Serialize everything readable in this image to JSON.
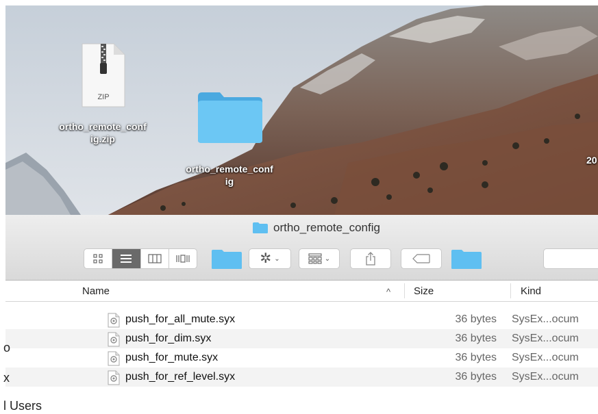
{
  "desktop": {
    "zip_file": {
      "badge": "ZIP",
      "label_line1": "ortho_remote_conf",
      "label_line2": "ig.zip"
    },
    "folder": {
      "label_line1": "ortho_remote_conf",
      "label_line2": "ig"
    },
    "clipped_label": "20"
  },
  "finder": {
    "title": "ortho_remote_config",
    "columns": {
      "name": "Name",
      "size": "Size",
      "kind": "Kind",
      "sort_indicator": "^"
    },
    "files": [
      {
        "name": "push_for_all_mute.syx",
        "size": "36 bytes",
        "kind": "SysEx...ocum"
      },
      {
        "name": "push_for_dim.syx",
        "size": "36 bytes",
        "kind": "SysEx...ocum"
      },
      {
        "name": "push_for_mute.syx",
        "size": "36 bytes",
        "kind": "SysEx...ocum"
      },
      {
        "name": "push_for_ref_level.syx",
        "size": "36 bytes",
        "kind": "SysEx...ocum"
      }
    ],
    "sidebar_fragments": [
      "o",
      "x",
      "l Users"
    ]
  },
  "colors": {
    "folder": "#5fbff1",
    "view_active": "#6a6a6a"
  }
}
